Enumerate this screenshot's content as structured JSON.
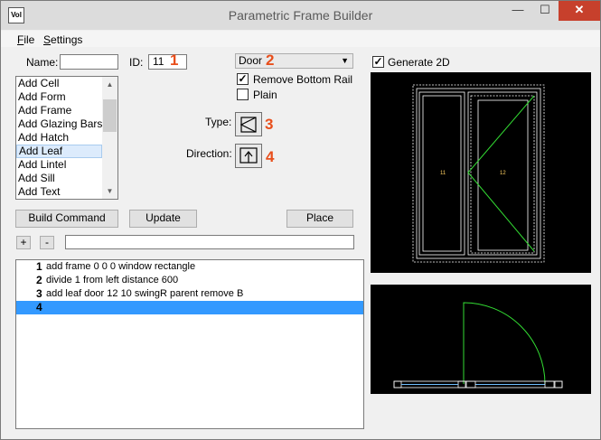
{
  "window": {
    "title": "Parametric Frame Builder",
    "icon_text": "Vol",
    "minimize_glyph": "—",
    "maximize_glyph": "☐",
    "close_glyph": "✕"
  },
  "menu": {
    "items": [
      {
        "label": "File"
      },
      {
        "label": "Settings"
      }
    ]
  },
  "form": {
    "name_label": "Name:",
    "name_value": "",
    "id_label": "ID:",
    "id_value": "11",
    "type_dropdown_value": "Door",
    "remove_bottom_rail_label": "Remove Bottom Rail",
    "remove_bottom_rail_checked": true,
    "plain_label": "Plain",
    "plain_checked": false,
    "type_label": "Type:",
    "direction_label": "Direction:",
    "check_glyph": "✓"
  },
  "callouts": {
    "one": "1",
    "two": "2",
    "three": "3",
    "four": "4"
  },
  "command_types": {
    "items": [
      "Add Cell",
      "Add Form",
      "Add Frame",
      "Add Glazing Bars",
      "Add Hatch",
      "Add Leaf",
      "Add Lintel",
      "Add Sill",
      "Add Text"
    ],
    "selected": "Add Leaf"
  },
  "buttons": {
    "build_command": "Build Command",
    "update": "Update",
    "place": "Place",
    "plus": "+",
    "minus": "-"
  },
  "command_input": {
    "value": ""
  },
  "commands": [
    {
      "num": "1",
      "text": "add frame 0 0 0 window rectangle"
    },
    {
      "num": "2",
      "text": "divide 1 from left distance 600"
    },
    {
      "num": "3",
      "text": "add leaf door 12 10 swingR parent remove B"
    },
    {
      "num": "4",
      "text": ""
    }
  ],
  "generate_2d": {
    "label": "Generate 2D",
    "checked": true
  },
  "preview_elevation": {
    "left_cell_label": "11",
    "right_cell_label": "12",
    "background": "#000000",
    "frame_color": "#ffffff",
    "swing_color": "#33dd33"
  },
  "colors": {
    "callout": "#e84e1b",
    "selection": "#3399ff",
    "close_button": "#c7402c"
  }
}
